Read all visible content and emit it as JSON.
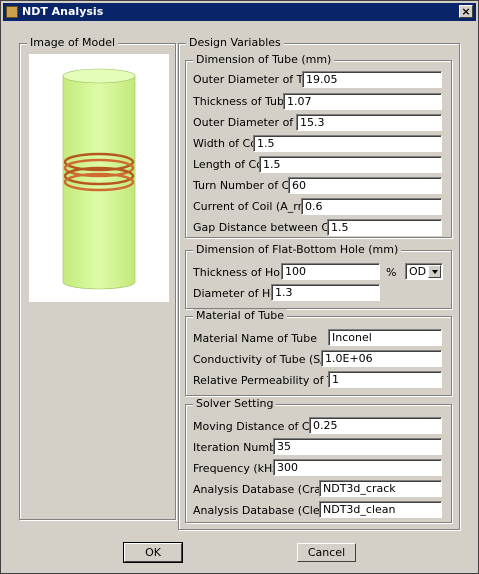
{
  "window": {
    "title": "NDT Analysis",
    "close_label": "×"
  },
  "image_group": {
    "legend": "Image of Model"
  },
  "design_group": {
    "legend": "Design Variables"
  },
  "tube_dimension": {
    "legend": "Dimension of Tube (mm)",
    "fields": [
      {
        "label": "Outer Diameter of Tube",
        "value": "19.05"
      },
      {
        "label": "Thickness of Tube",
        "value": "1.07"
      },
      {
        "label": "Outer Diameter of Coil",
        "value": "15.3"
      },
      {
        "label": "Width of Coil",
        "value": "1.5"
      },
      {
        "label": "Length of Coil",
        "value": "1.5"
      },
      {
        "label": "Turn Number of Coil",
        "value": "60"
      },
      {
        "label": "Current of Coil (A_rms)",
        "value": "0.6"
      },
      {
        "label": "Gap Distance between Coils",
        "value": "1.5"
      }
    ]
  },
  "hole_dimension": {
    "legend": "Dimension of Flat-Bottom Hole (mm)",
    "thickness_label": "Thickness of Hole",
    "thickness_value": "100",
    "percent_label": "%",
    "side_selected": "OD",
    "diameter_label": "Diameter of Hole",
    "diameter_value": "1.3"
  },
  "material": {
    "legend": "Material of Tube",
    "fields": [
      {
        "label": "Material Name of Tube",
        "value": "Inconel"
      },
      {
        "label": "Conductivity of Tube (S/m)",
        "value": "1.0E+06"
      },
      {
        "label": "Relative Permeability of Tube",
        "value": "1"
      }
    ]
  },
  "solver": {
    "legend": "Solver Setting",
    "fields": [
      {
        "label": "Moving Distance of Coils",
        "value": "0.25"
      },
      {
        "label": "Iteration Number",
        "value": "35"
      },
      {
        "label": "Frequency (kHz)",
        "value": "300"
      },
      {
        "label": "Analysis Database (Crack)",
        "value": "NDT3d_crack"
      },
      {
        "label": "Analysis Database (Clean)",
        "value": "NDT3d_clean"
      }
    ]
  },
  "buttons": {
    "ok": "OK",
    "cancel": "Cancel"
  },
  "colors": {
    "titlebar": "#0a246a",
    "dialog_bg": "#d4d0c8",
    "tube": "#d6f59a",
    "coil": "#c8602a"
  }
}
